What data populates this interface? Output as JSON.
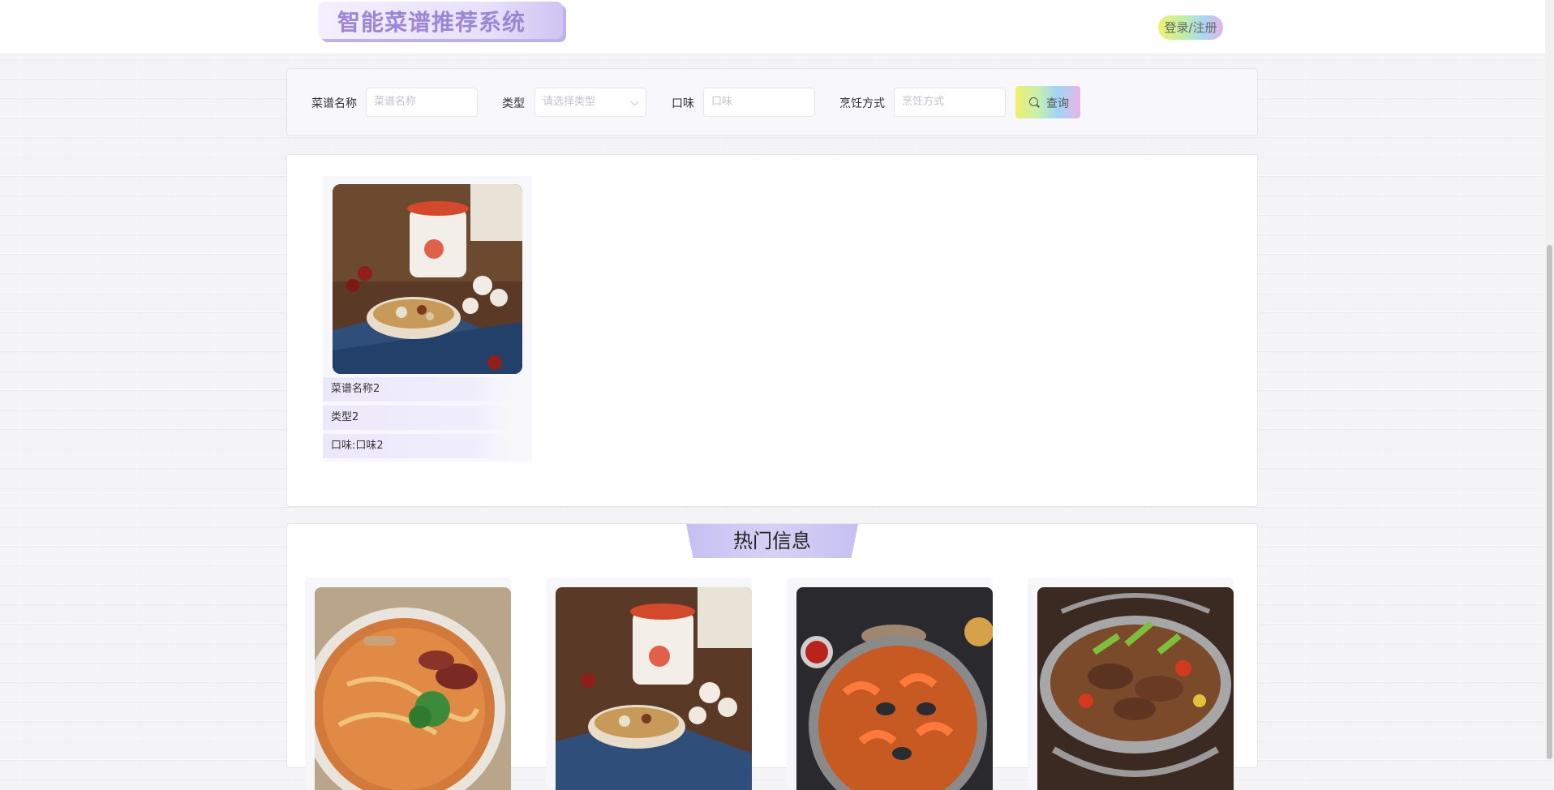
{
  "header": {
    "title": "智能菜谱推荐系统",
    "login_label": "登录/注册"
  },
  "search": {
    "name_label": "菜谱名称",
    "name_placeholder": "菜谱名称",
    "type_label": "类型",
    "type_placeholder": "请选择类型",
    "taste_label": "口味",
    "taste_placeholder": "口味",
    "method_label": "烹饪方式",
    "method_placeholder": "烹饪方式",
    "search_button": "查询"
  },
  "results": [
    {
      "name": "菜谱名称2",
      "type": "类型2",
      "taste": "口味:口味2",
      "image": "soup-with-teapot-photo"
    }
  ],
  "hot": {
    "title": "热门信息",
    "items": [
      {
        "image": "noodle-soup-photo"
      },
      {
        "image": "soup-with-teapot-photo"
      },
      {
        "image": "seafood-paella-photo"
      },
      {
        "image": "dry-pot-beef-photo"
      }
    ]
  },
  "colors": {
    "accent_purple": "#9d86d6",
    "title_band": "#c6c0f2",
    "panel_bg": "#f7f7fc"
  }
}
